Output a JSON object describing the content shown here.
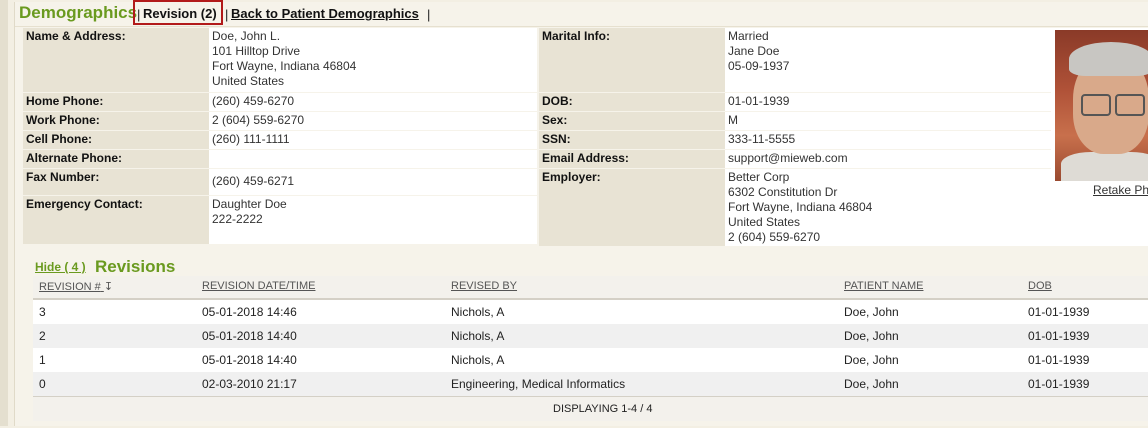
{
  "header": {
    "title": "Demographics",
    "sep1": "|",
    "revision_link": "Revision (2)",
    "sep2": "|",
    "back_link": "Back to Patient Demographics",
    "sep3": "|"
  },
  "demographics": {
    "name_address": {
      "label": "Name & Address:",
      "lines": [
        "Doe, John L.",
        "101 Hilltop Drive",
        "Fort Wayne, Indiana 46804",
        "United States"
      ]
    },
    "home_phone": {
      "label": "Home Phone:",
      "value": "(260) 459-6270"
    },
    "work_phone": {
      "label": "Work Phone:",
      "value": "2 (604) 559-6270"
    },
    "cell_phone": {
      "label": "Cell Phone:",
      "value": "(260) 111-1111"
    },
    "alternate_phone": {
      "label": "Alternate Phone:",
      "value": ""
    },
    "fax_number": {
      "label": "Fax Number:",
      "value": "(260) 459-6271"
    },
    "emergency_contact": {
      "label": "Emergency Contact:",
      "lines": [
        "Daughter Doe",
        "222-2222"
      ]
    },
    "marital_info": {
      "label": "Marital Info:",
      "lines": [
        "Married",
        "Jane Doe",
        "05-09-1937"
      ]
    },
    "dob": {
      "label": "DOB:",
      "value": "01-01-1939"
    },
    "sex": {
      "label": "Sex:",
      "value": "M"
    },
    "ssn": {
      "label": "SSN:",
      "value": "333-11-5555"
    },
    "email": {
      "label": "Email Address:",
      "value": "support@mieweb.com"
    },
    "employer": {
      "label": "Employer:",
      "lines": [
        "Better Corp",
        "6302 Constitution Dr",
        "Fort Wayne, Indiana 46804",
        "United States",
        "2 (604) 559-6270"
      ]
    },
    "photo_action": "Retake Pho"
  },
  "revisions": {
    "hide_link": "Hide ( 4 )",
    "title": "Revisions",
    "columns": [
      "REVISION #",
      "REVISION DATE/TIME",
      "REVISED BY",
      "PATIENT NAME",
      "DOB"
    ],
    "sort_icon": "sort-descending-icon",
    "rows": [
      [
        "3",
        "05-01-2018 14:46",
        "Nichols, A",
        "Doe, John",
        "01-01-1939"
      ],
      [
        "2",
        "05-01-2018 14:40",
        "Nichols, A",
        "Doe, John",
        "01-01-1939"
      ],
      [
        "1",
        "05-01-2018 14:40",
        "Nichols, A",
        "Doe, John",
        "01-01-1939"
      ],
      [
        "0",
        "02-03-2010 21:17",
        "Engineering, Medical Informatics",
        "Doe, John",
        "01-01-1939"
      ]
    ],
    "footer": "DISPLAYING 1-4 / 4"
  },
  "colors": {
    "accent_green": "#6a9a1f",
    "highlight_red": "#b21a1a",
    "label_bg": "#e8e3d4"
  }
}
